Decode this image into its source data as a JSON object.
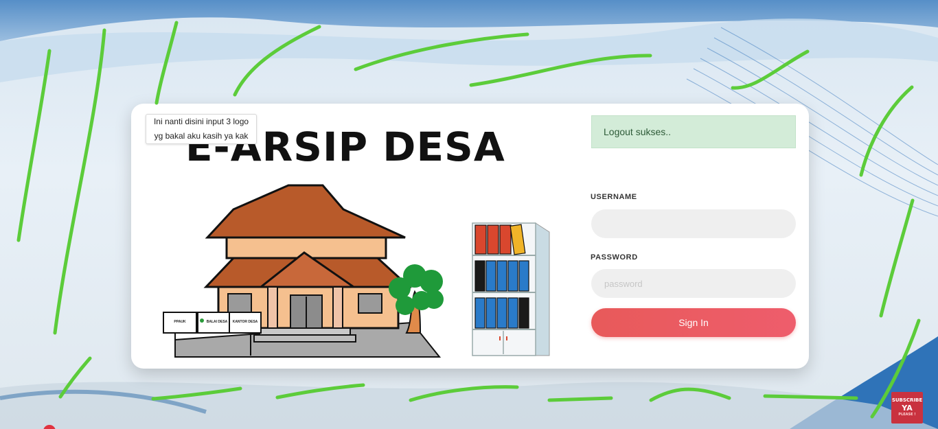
{
  "tooltip": {
    "line1": "Ini nanti disini input 3 logo",
    "line2": "yg bakal aku kasih ya kak"
  },
  "app": {
    "title": "E-ARSIP DESA"
  },
  "alert": {
    "text": "Logout sukses.."
  },
  "form": {
    "username_label": "USERNAME",
    "username_value": "",
    "password_label": "PASSWORD",
    "password_placeholder": "password",
    "signin_label": "Sign In"
  },
  "signs": [
    "PPAUK",
    "BALAI DESA",
    "KANTOR DESA"
  ],
  "badge": {
    "line1": "SUBSCRIBE",
    "line2": "YA",
    "line3": "PLEASE !"
  },
  "colors": {
    "accent": "#e85a5a",
    "alert_bg": "#d3ecd8",
    "scribble": "#5ccc3a",
    "roof": "#b85a2a",
    "wall": "#f5c08f"
  }
}
